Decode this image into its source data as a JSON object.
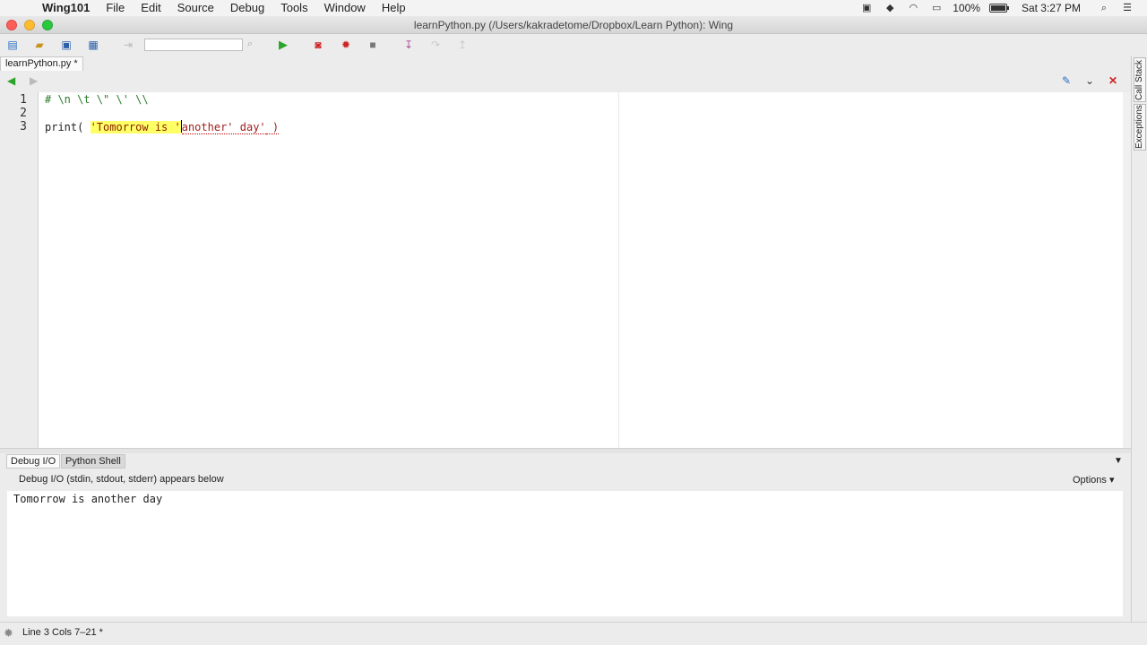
{
  "menubar": {
    "apple_glyph": "",
    "items": [
      "Wing101",
      "File",
      "Edit",
      "Source",
      "Debug",
      "Tools",
      "Window",
      "Help"
    ],
    "battery_text": "100%",
    "battery_level": 1.0,
    "clock": "Sat 3:27 PM"
  },
  "window": {
    "title": "learnPython.py (/Users/kakradetome/Dropbox/Learn Python): Wing"
  },
  "editor": {
    "tab_label": "learnPython.py *",
    "lines": [
      {
        "num": "1",
        "text": "# \\n \\t \\\" \\' \\\\"
      },
      {
        "num": "2",
        "text": ""
      },
      {
        "num": "3",
        "prefix": "print( ",
        "highlight": "'Tomorrow is '",
        "error_part": "another' day'",
        "suffix": " )"
      }
    ]
  },
  "side_tabs": [
    "Call Stack",
    "Exceptions"
  ],
  "bottom_panel": {
    "tabs": [
      "Debug I/O",
      "Python Shell"
    ],
    "header": "Debug I/O (stdin, stdout, stderr) appears below",
    "options_label": "Options",
    "output": "Tomorrow is another day"
  },
  "statusbar": {
    "text": "Line 3 Cols 7–21 *"
  },
  "colors": {
    "string_highlight": "#ffff66",
    "comment": "#2d7d2d",
    "run_green": "#2aa52a",
    "debug_red": "#cc2222"
  }
}
